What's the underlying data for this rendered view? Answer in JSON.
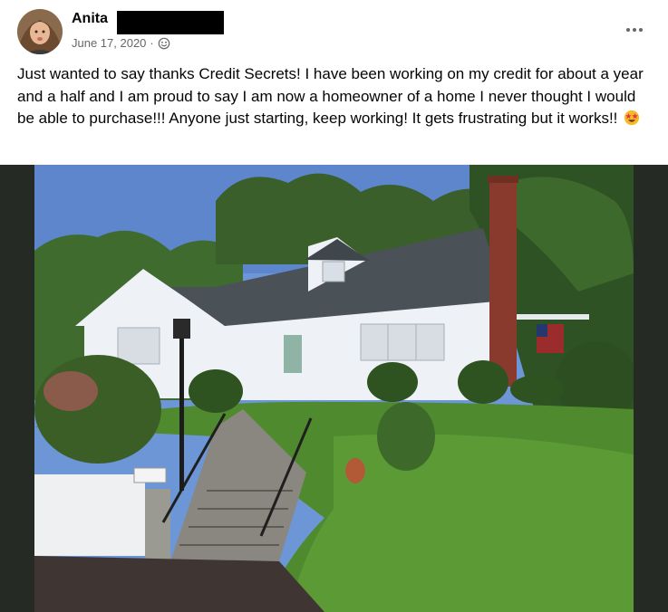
{
  "post": {
    "author": "Anita",
    "date": "June 17, 2020",
    "separator": "·",
    "privacy_icon": "globe-icon",
    "text": "Just wanted to say thanks Credit Secrets! I have been working on my credit for about a year and a half and I am proud to say I am now a homeowner of a home I never thought I would be able to purchase!!! Anyone just starting, keep working! It gets frustrating but it works!!",
    "emoji": "star-struck-emoji",
    "more_icon": "more-options-icon"
  },
  "colors": {
    "text": "#050505",
    "secondary_text": "#65676b",
    "photo_background": "#262a24"
  }
}
